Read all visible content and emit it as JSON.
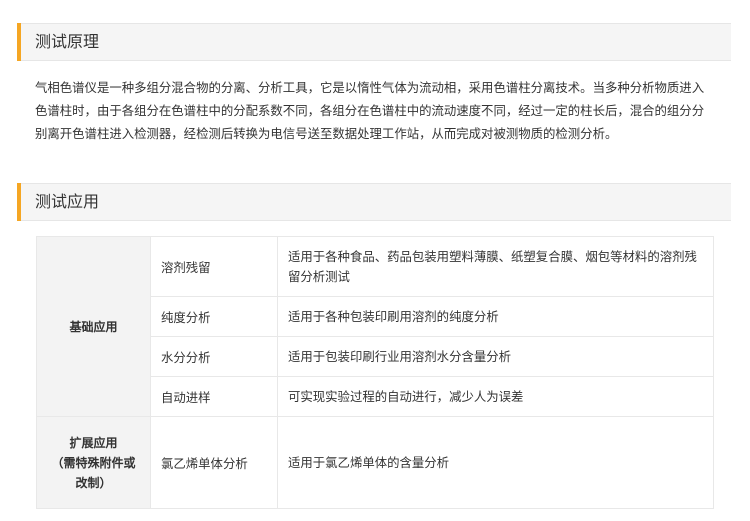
{
  "principle": {
    "title": "测试原理",
    "text": "气相色谱仪是一种多组分混合物的分离、分析工具，它是以惰性气体为流动相，采用色谱柱分离技术。当多种分析物质进入色谱柱时，由于各组分在色谱柱中的分配系数不同，各组分在色谱柱中的流动速度不同，经过一定的柱长后，混合的组分分别离开色谱柱进入检测器，经检测后转换为电信号送至数据处理工作站，从而完成对被测物质的检测分析。"
  },
  "application": {
    "title": "测试应用",
    "categories": [
      {
        "lines": [
          "基础应用"
        ]
      },
      {
        "lines": [
          "扩展应用",
          "（需特殊附件或",
          "改制）"
        ]
      }
    ],
    "rows": [
      {
        "name": "溶剂残留",
        "desc": "适用于各种食品、药品包装用塑料薄膜、纸塑复合膜、烟包等材料的溶剂残留分析测试"
      },
      {
        "name": "纯度分析",
        "desc": "适用于各种包装印刷用溶剂的纯度分析"
      },
      {
        "name": "水分分析",
        "desc": "适用于包装印刷行业用溶剂水分含量分析"
      },
      {
        "name": "自动进样",
        "desc": "可实现实验过程的自动进行，减少人为误差"
      },
      {
        "name": "氯乙烯单体分析",
        "desc": "适用于氯乙烯单体的含量分析"
      }
    ]
  },
  "colors": {
    "accent": "#f5a623",
    "header_bg": "#f5f5f5",
    "category_bg": "#f3f3f3",
    "border": "#e8e8e8"
  }
}
